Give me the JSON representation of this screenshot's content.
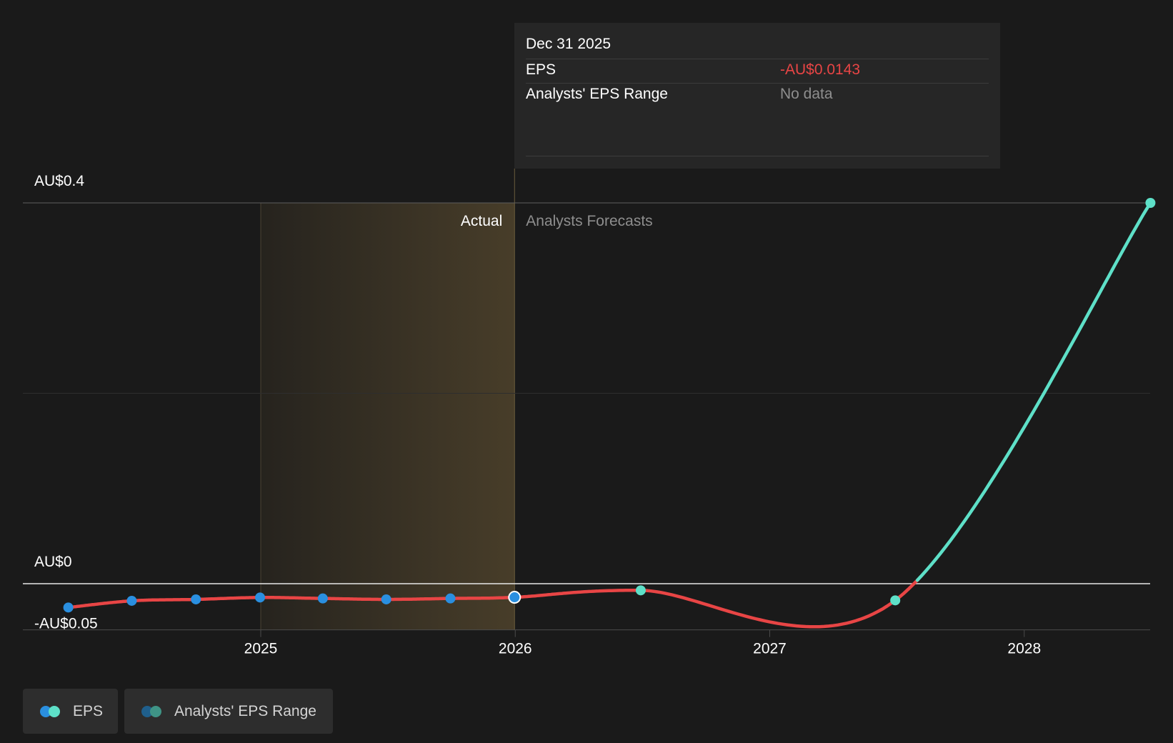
{
  "colors": {
    "background": "#1a1a1a",
    "eps_actual": "#2a8fe0",
    "eps_forecast": "#5ee0c8",
    "negative_line": "#e84545",
    "negative_value": "#e84545",
    "range_blue": "#1f5f8c",
    "range_teal": "#3f9486",
    "actual_band": "#4a3f2a"
  },
  "tooltip": {
    "date": "Dec 31 2025",
    "rows": [
      {
        "label": "EPS",
        "value": "-AU$0.0143"
      },
      {
        "label": "Analysts' EPS Range",
        "value": "No data"
      }
    ]
  },
  "region_labels": {
    "actual": "Actual",
    "forecast": "Analysts Forecasts"
  },
  "legend": [
    {
      "label": "EPS",
      "icon": "eps-dots-icon"
    },
    {
      "label": "Analysts' EPS Range",
      "icon": "range-dots-icon"
    }
  ],
  "chart_data": {
    "type": "line",
    "title": "",
    "xlabel": "",
    "ylabel": "",
    "x_ticks": [
      "2025",
      "2026",
      "2027",
      "2028"
    ],
    "y_tick_labels": [
      "AU$0.4",
      "AU$0",
      "-AU$0.05"
    ],
    "ylim": [
      -0.05,
      0.4
    ],
    "grid": true,
    "actual_band": [
      "2025-01-01",
      "2025-12-31"
    ],
    "series": [
      {
        "name": "EPS",
        "points": [
          {
            "x": "2024-03-31",
            "y": -0.025,
            "kind": "actual"
          },
          {
            "x": "2024-06-30",
            "y": -0.018,
            "kind": "actual"
          },
          {
            "x": "2024-09-30",
            "y": -0.0165,
            "kind": "actual"
          },
          {
            "x": "2024-12-31",
            "y": -0.0145,
            "kind": "actual"
          },
          {
            "x": "2025-03-31",
            "y": -0.0155,
            "kind": "actual"
          },
          {
            "x": "2025-06-30",
            "y": -0.0165,
            "kind": "actual"
          },
          {
            "x": "2025-09-30",
            "y": -0.0155,
            "kind": "actual"
          },
          {
            "x": "2025-12-31",
            "y": -0.0143,
            "kind": "actual"
          },
          {
            "x": "2026-06-30",
            "y": -0.007,
            "kind": "forecast"
          },
          {
            "x": "2027-06-30",
            "y": -0.0175,
            "kind": "forecast"
          },
          {
            "x": "2028-06-30",
            "y": 0.4,
            "kind": "forecast"
          }
        ]
      }
    ]
  }
}
